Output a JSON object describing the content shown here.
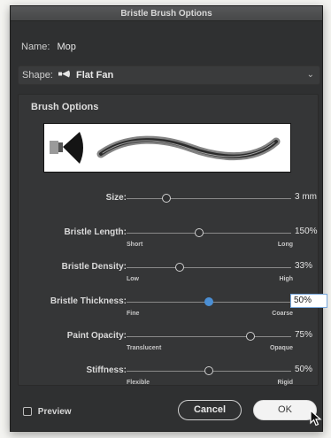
{
  "dialog": {
    "title": "Bristle Brush Options"
  },
  "name": {
    "label": "Name:",
    "value": "Mop"
  },
  "shape": {
    "label": "Shape:",
    "value": "Flat Fan",
    "icon": "flat-fan-brush-icon"
  },
  "brush_options": {
    "title": "Brush Options",
    "sliders": [
      {
        "label": "Size:",
        "value_text": "3 mm",
        "level": 0.24,
        "min_label": "",
        "max_label": ""
      },
      {
        "label": "Bristle Length:",
        "value_text": "150%",
        "level": 0.44,
        "min_label": "Short",
        "max_label": "Long"
      },
      {
        "label": "Bristle Density:",
        "value_text": "33%",
        "level": 0.32,
        "min_label": "Low",
        "max_label": "High"
      },
      {
        "label": "Bristle Thickness:",
        "value_text": "50%",
        "level": 0.5,
        "min_label": "Fine",
        "max_label": "Coarse",
        "editing": true,
        "accent": "#4b8fd4"
      },
      {
        "label": "Paint Opacity:",
        "value_text": "75%",
        "level": 0.75,
        "min_label": "Translucent",
        "max_label": "Opaque"
      },
      {
        "label": "Stiffness:",
        "value_text": "50%",
        "level": 0.5,
        "min_label": "Flexible",
        "max_label": "Rigid"
      }
    ]
  },
  "footer": {
    "preview_label": "Preview",
    "preview_checked": false,
    "cancel_label": "Cancel",
    "ok_label": "OK"
  }
}
